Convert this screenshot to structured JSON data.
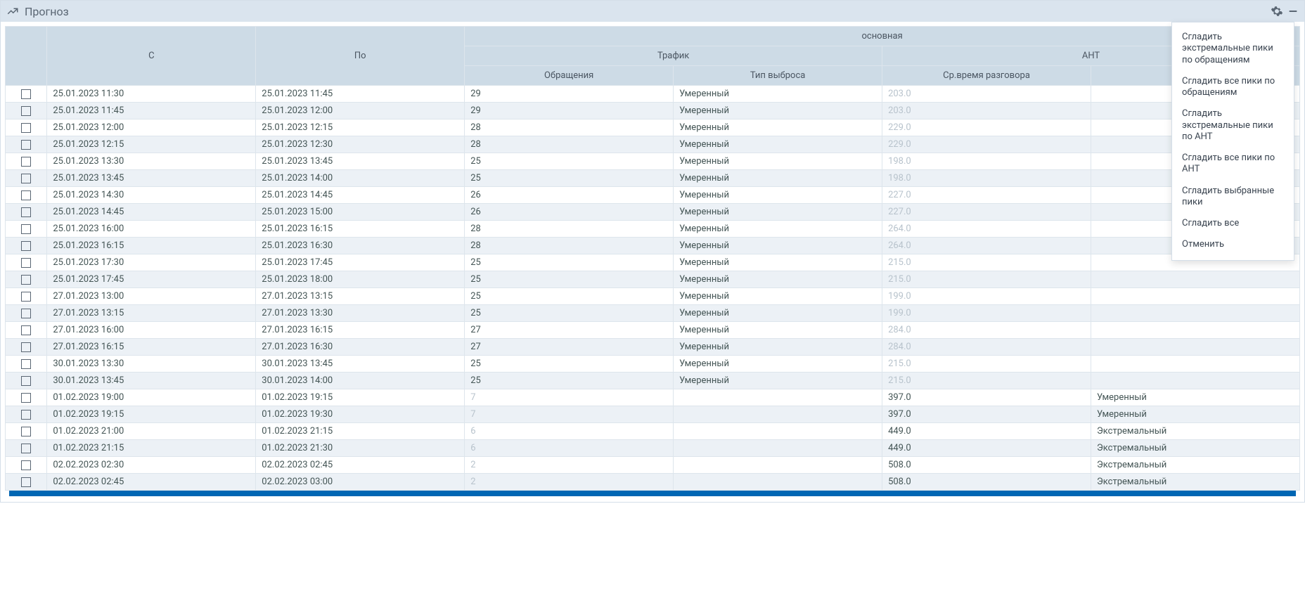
{
  "panel": {
    "title": "Прогноз"
  },
  "headers": {
    "from": "С",
    "to": "По",
    "group": "основная",
    "traffic": "Трафик",
    "aht": "АНТ",
    "requests": "Обращения",
    "burst_type": "Тип выброса",
    "avg_talk": "Ср.время разговора"
  },
  "menu": [
    "Сгладить экстремальные пики по обращениям",
    "Сгладить все пики по обращениям",
    "Сгладить экстремальные пики по АНТ",
    "Сгладить все пики по АНТ",
    "Сгладить выбранные пики",
    "Сгладить все",
    "Отменить"
  ],
  "rows": [
    {
      "from": "25.01.2023 11:30",
      "to": "25.01.2023 11:45",
      "req": "29",
      "burst": "Умеренный",
      "aht": "203.0",
      "bt2": "",
      "req_faded": false,
      "aht_faded": true
    },
    {
      "from": "25.01.2023 11:45",
      "to": "25.01.2023 12:00",
      "req": "29",
      "burst": "Умеренный",
      "aht": "203.0",
      "bt2": "",
      "req_faded": false,
      "aht_faded": true
    },
    {
      "from": "25.01.2023 12:00",
      "to": "25.01.2023 12:15",
      "req": "28",
      "burst": "Умеренный",
      "aht": "229.0",
      "bt2": "",
      "req_faded": false,
      "aht_faded": true
    },
    {
      "from": "25.01.2023 12:15",
      "to": "25.01.2023 12:30",
      "req": "28",
      "burst": "Умеренный",
      "aht": "229.0",
      "bt2": "",
      "req_faded": false,
      "aht_faded": true
    },
    {
      "from": "25.01.2023 13:30",
      "to": "25.01.2023 13:45",
      "req": "25",
      "burst": "Умеренный",
      "aht": "198.0",
      "bt2": "",
      "req_faded": false,
      "aht_faded": true
    },
    {
      "from": "25.01.2023 13:45",
      "to": "25.01.2023 14:00",
      "req": "25",
      "burst": "Умеренный",
      "aht": "198.0",
      "bt2": "",
      "req_faded": false,
      "aht_faded": true
    },
    {
      "from": "25.01.2023 14:30",
      "to": "25.01.2023 14:45",
      "req": "26",
      "burst": "Умеренный",
      "aht": "227.0",
      "bt2": "",
      "req_faded": false,
      "aht_faded": true
    },
    {
      "from": "25.01.2023 14:45",
      "to": "25.01.2023 15:00",
      "req": "26",
      "burst": "Умеренный",
      "aht": "227.0",
      "bt2": "",
      "req_faded": false,
      "aht_faded": true
    },
    {
      "from": "25.01.2023 16:00",
      "to": "25.01.2023 16:15",
      "req": "28",
      "burst": "Умеренный",
      "aht": "264.0",
      "bt2": "",
      "req_faded": false,
      "aht_faded": true
    },
    {
      "from": "25.01.2023 16:15",
      "to": "25.01.2023 16:30",
      "req": "28",
      "burst": "Умеренный",
      "aht": "264.0",
      "bt2": "",
      "req_faded": false,
      "aht_faded": true
    },
    {
      "from": "25.01.2023 17:30",
      "to": "25.01.2023 17:45",
      "req": "25",
      "burst": "Умеренный",
      "aht": "215.0",
      "bt2": "",
      "req_faded": false,
      "aht_faded": true
    },
    {
      "from": "25.01.2023 17:45",
      "to": "25.01.2023 18:00",
      "req": "25",
      "burst": "Умеренный",
      "aht": "215.0",
      "bt2": "",
      "req_faded": false,
      "aht_faded": true
    },
    {
      "from": "27.01.2023 13:00",
      "to": "27.01.2023 13:15",
      "req": "25",
      "burst": "Умеренный",
      "aht": "199.0",
      "bt2": "",
      "req_faded": false,
      "aht_faded": true
    },
    {
      "from": "27.01.2023 13:15",
      "to": "27.01.2023 13:30",
      "req": "25",
      "burst": "Умеренный",
      "aht": "199.0",
      "bt2": "",
      "req_faded": false,
      "aht_faded": true
    },
    {
      "from": "27.01.2023 16:00",
      "to": "27.01.2023 16:15",
      "req": "27",
      "burst": "Умеренный",
      "aht": "284.0",
      "bt2": "",
      "req_faded": false,
      "aht_faded": true
    },
    {
      "from": "27.01.2023 16:15",
      "to": "27.01.2023 16:30",
      "req": "27",
      "burst": "Умеренный",
      "aht": "284.0",
      "bt2": "",
      "req_faded": false,
      "aht_faded": true
    },
    {
      "from": "30.01.2023 13:30",
      "to": "30.01.2023 13:45",
      "req": "25",
      "burst": "Умеренный",
      "aht": "215.0",
      "bt2": "",
      "req_faded": false,
      "aht_faded": true
    },
    {
      "from": "30.01.2023 13:45",
      "to": "30.01.2023 14:00",
      "req": "25",
      "burst": "Умеренный",
      "aht": "215.0",
      "bt2": "",
      "req_faded": false,
      "aht_faded": true
    },
    {
      "from": "01.02.2023 19:00",
      "to": "01.02.2023 19:15",
      "req": "7",
      "burst": "",
      "aht": "397.0",
      "bt2": "Умеренный",
      "req_faded": true,
      "aht_faded": false
    },
    {
      "from": "01.02.2023 19:15",
      "to": "01.02.2023 19:30",
      "req": "7",
      "burst": "",
      "aht": "397.0",
      "bt2": "Умеренный",
      "req_faded": true,
      "aht_faded": false
    },
    {
      "from": "01.02.2023 21:00",
      "to": "01.02.2023 21:15",
      "req": "6",
      "burst": "",
      "aht": "449.0",
      "bt2": "Экстремальный",
      "req_faded": true,
      "aht_faded": false
    },
    {
      "from": "01.02.2023 21:15",
      "to": "01.02.2023 21:30",
      "req": "6",
      "burst": "",
      "aht": "449.0",
      "bt2": "Экстремальный",
      "req_faded": true,
      "aht_faded": false
    },
    {
      "from": "02.02.2023 02:30",
      "to": "02.02.2023 02:45",
      "req": "2",
      "burst": "",
      "aht": "508.0",
      "bt2": "Экстремальный",
      "req_faded": true,
      "aht_faded": false
    },
    {
      "from": "02.02.2023 02:45",
      "to": "02.02.2023 03:00",
      "req": "2",
      "burst": "",
      "aht": "508.0",
      "bt2": "Экстремальный",
      "req_faded": true,
      "aht_faded": false
    }
  ]
}
